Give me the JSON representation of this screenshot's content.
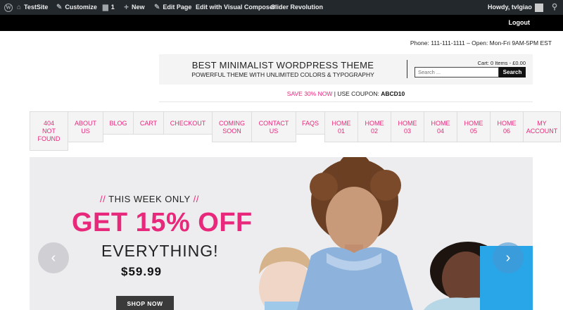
{
  "admin_bar": {
    "site": "TestSite",
    "customize": "Customize",
    "comments": "1",
    "new": "New",
    "edit_page": "Edit Page",
    "visual_composer": "Edit with Visual Composer",
    "slider_revolution": "Slider Revolution",
    "howdy": "Howdy, tvlgiao"
  },
  "topbar": {
    "logout": "Logout"
  },
  "contact": {
    "phone_line": "Phone: 111-111-1111 – Open: Mon-Fri 9AM-5PM EST"
  },
  "header": {
    "title": "BEST MINIMALIST WORDPRESS THEME",
    "subtitle": "POWERFUL THEME WITH UNLIMITED COLORS & TYPOGRAPHY",
    "cart": "Cart: 0 Items - £0.00",
    "search_placeholder": "Search ...",
    "search_button": "Search"
  },
  "promo": {
    "save": "SAVE 30% NOW",
    "separator": "|",
    "coupon_label": "USE COUPON:",
    "coupon_code": "ABCD10"
  },
  "nav": [
    {
      "line1": "404",
      "line2": "NOT",
      "line3": "FOUND"
    },
    {
      "line1": "ABOUT",
      "line2": "US",
      "line3": ""
    },
    {
      "line1": "BLOG",
      "line2": "",
      "line3": ""
    },
    {
      "line1": "CART",
      "line2": "",
      "line3": ""
    },
    {
      "line1": "CHECKOUT",
      "line2": "",
      "line3": ""
    },
    {
      "line1": "COMING",
      "line2": "SOON",
      "line3": ""
    },
    {
      "line1": "CONTACT",
      "line2": "US",
      "line3": ""
    },
    {
      "line1": "FAQS",
      "line2": "",
      "line3": ""
    },
    {
      "line1": "HOME",
      "line2": "01",
      "line3": ""
    },
    {
      "line1": "HOME",
      "line2": "02",
      "line3": ""
    },
    {
      "line1": "HOME",
      "line2": "03",
      "line3": ""
    },
    {
      "line1": "HOME",
      "line2": "04",
      "line3": ""
    },
    {
      "line1": "HOME",
      "line2": "05",
      "line3": ""
    },
    {
      "line1": "HOME",
      "line2": "06",
      "line3": ""
    },
    {
      "line1": "MY",
      "line2": "ACCOUNT",
      "line3": ""
    }
  ],
  "slider": {
    "slashes_left": "//",
    "week": "THIS WEEK ONLY",
    "slashes_right": "//",
    "headline": "GET 15% OFF",
    "subheadline": "EVERYTHING!",
    "price": "$59.99",
    "cta": "SHOP NOW"
  },
  "colors": {
    "accent": "#e8287b",
    "admin_bar": "#23282d"
  }
}
